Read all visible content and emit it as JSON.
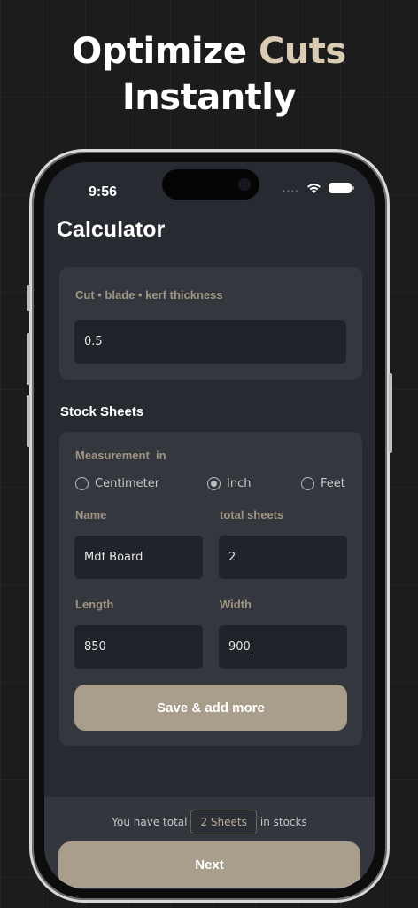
{
  "headline": {
    "line1": "Optimize",
    "accent": "Cuts",
    "line2": "Instantly"
  },
  "status_bar": {
    "time": "9:56",
    "signal": "....",
    "wifi_icon": "wifi-icon",
    "battery_icon": "battery-icon"
  },
  "page": {
    "title": "Calculator"
  },
  "kerf": {
    "label": "Cut • blade • kerf thickness",
    "value": "0.5"
  },
  "stock": {
    "section_title": "Stock Sheets",
    "measurement_label": "Measurement  in",
    "units": [
      {
        "label": "Centimeter",
        "selected": false
      },
      {
        "label": "Inch",
        "selected": true
      },
      {
        "label": "Feet",
        "selected": false
      }
    ],
    "name_label": "Name",
    "name_value": "Mdf Board",
    "total_label": "total sheets",
    "total_value": "2",
    "length_label": "Length",
    "length_value": "850",
    "width_label": "Width",
    "width_value": "900",
    "save_label": "Save & add more"
  },
  "footer": {
    "prefix": "You have total",
    "badge": "2 Sheets",
    "suffix": "in stocks",
    "next_label": "Next"
  },
  "colors": {
    "accent": "#d9cbb4",
    "button": "#a99d8c",
    "screen_bg": "#272a30",
    "card_bg": "#34373d",
    "field_bg": "#202329"
  }
}
